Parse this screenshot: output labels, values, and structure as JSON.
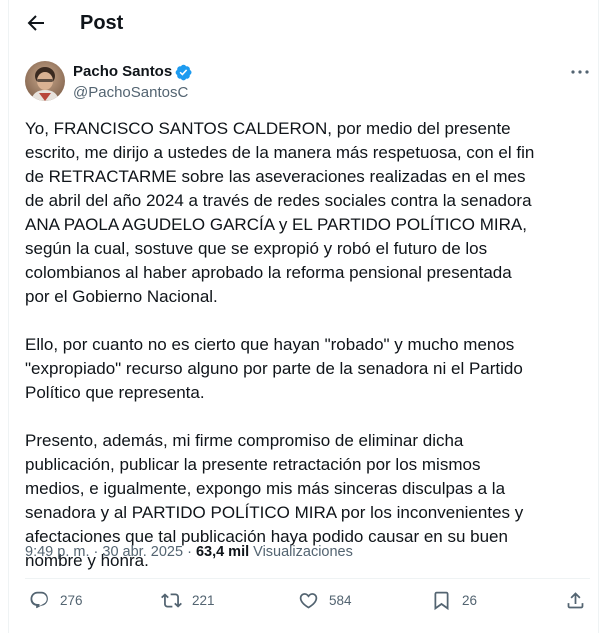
{
  "header": {
    "title": "Post"
  },
  "author": {
    "name": "Pacho Santos",
    "handle": "@PachoSantosC"
  },
  "post": {
    "paragraphs": [
      "Yo, FRANCISCO SANTOS CALDERON, por medio del presente escrito, me dirijo a ustedes de la manera más respetuosa, con el fin de RETRACTARME sobre las aseveraciones realizadas en el mes de abril del año 2024 a través de redes sociales contra la senadora ANA PAOLA AGUDELO GARCÍA y EL PARTIDO POLÍTICO MIRA, según la cual, sostuve que se expropió y robó el futuro de los colombianos al haber aprobado la reforma pensional presentada por el Gobierno Nacional.",
      "Ello, por cuanto no es cierto que hayan \"robado\" y mucho menos \"expropiado\" recurso alguno por parte de la senadora ni el Partido Político que representa.",
      "Presento, además, mi firme compromiso de eliminar dicha publicación, publicar la presente retractación por los mismos medios, e igualmente, expongo mis más sinceras disculpas a la senadora y al PARTIDO POLÍTICO MIRA por los inconvenientes y afectaciones que tal publicación haya podido causar en su buen nombre y honra."
    ],
    "time": "9:49 p. m.",
    "separator": "·",
    "date": "30 abr. 2025",
    "views_count": "63,4 mil",
    "views_label": "Visualizaciones"
  },
  "actions": {
    "replies": "276",
    "reposts": "221",
    "likes": "584",
    "bookmarks": "26"
  },
  "colors": {
    "accent": "#1d9bf0",
    "text": "#0f1419",
    "secondary": "#536471",
    "border": "#eff3f4"
  },
  "icons": [
    "back-arrow-icon",
    "verified-badge-icon",
    "more-icon",
    "reply-icon",
    "repost-icon",
    "like-icon",
    "bookmark-icon",
    "share-icon"
  ]
}
